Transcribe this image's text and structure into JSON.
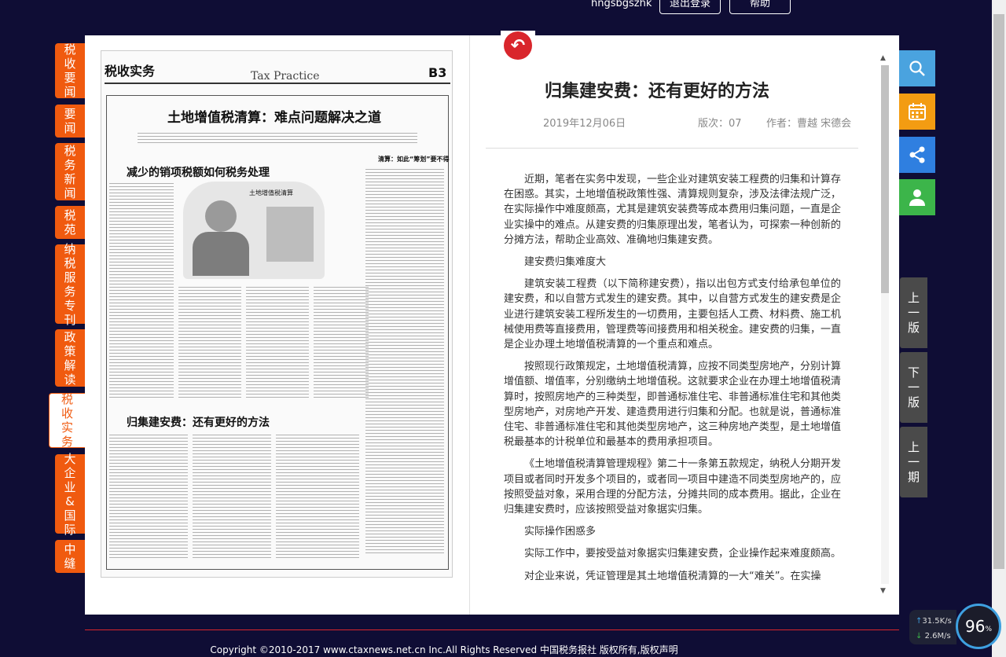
{
  "header": {
    "username": "hngsbgszhk",
    "logout_label": "退出登录",
    "help_label": "帮助"
  },
  "left_nav": [
    {
      "label": "税收要闻",
      "active": false
    },
    {
      "label": "要闻",
      "active": false
    },
    {
      "label": "税务新闻",
      "active": false
    },
    {
      "label": "税苑",
      "active": false
    },
    {
      "label": "纳税服务专刊",
      "active": false
    },
    {
      "label": "政策解读",
      "active": false
    },
    {
      "label": "税收实务",
      "active": true
    },
    {
      "label": "大企业&国际",
      "active": false
    },
    {
      "label": "中缝",
      "active": false
    }
  ],
  "newspaper": {
    "section_cn": "税收实务",
    "section_en": "Tax Practice",
    "page_code": "B3",
    "headline": "土地增值税清算：难点问题解决之道",
    "story1_title": "减少的销项税额如何税务处理",
    "story2_title": "归集建安费：还有更好的方法",
    "side_title": "清算：如此“筹划”要不得",
    "figure_label": "土地增值税清算"
  },
  "article": {
    "title": "归集建安费：还有更好的方法",
    "date": "2019年12月06日",
    "edition": "版次：07",
    "author": "作者：曹越 宋德会",
    "paragraphs": [
      "近期，笔者在实务中发现，一些企业对建筑安装工程费的归集和计算存在困惑。其实，土地增值税政策性强、清算规则复杂，涉及法律法规广泛，在实际操作中难度颇高，尤其是建筑安装费等成本费用归集问题，一直是企业实操中的难点。从建安费的归集原理出发，笔者认为，可探索一种创新的分摊方法，帮助企业高效、准确地归集建安费。",
      "建安费归集难度大",
      "建筑安装工程费（以下简称建安费），指以出包方式支付给承包单位的建安费，和以自营方式发生的建安费。其中，以自营方式发生的建安费是企业进行建筑安装工程所发生的一切费用，主要包括人工费、材料费、施工机械使用费等直接费用，管理费等间接费用和相关税金。建安费的归集，一直是企业办理土地增值税清算的一个重点和难点。",
      "按照现行政策规定，土地增值税清算，应按不同类型房地产，分别计算增值额、增值率，分别缴纳土地增值税。这就要求企业在办理土地增值税清算时，按照房地产的三种类型，即普通标准住宅、非普通标准住宅和其他类型房地产，对房地产开发、建造费用进行归集和分配。也就是说，普通标准住宅、非普通标准住宅和其他类型房地产，这三种房地产类型，是土地增值税最基本的计税单位和最基本的费用承担项目。",
      "《土地增值税清算管理规程》第二十一条第五款规定，纳税人分期开发项目或者同时开发多个项目的，或者同一项目中建造不同类型房地产的，应按照受益对象，采用合理的分配方法，分摊共同的成本费用。据此，企业在归集建安费时，应该按照受益对象据实归集。",
      "实际操作困惑多",
      "实际工作中，要按受益对象据实归集建安费，企业操作起来难度颇高。",
      "对企业来说，凭证管理是其土地增值税清算的一大“难关”。在实操"
    ]
  },
  "right_tools": [
    {
      "icon": "search-icon",
      "color": "#4aa3df"
    },
    {
      "icon": "calendar-icon",
      "color": "#f39c12"
    },
    {
      "icon": "share-icon",
      "color": "#2f7fe0"
    },
    {
      "icon": "user-icon",
      "color": "#3cb54a"
    }
  ],
  "pager": {
    "prev_page": "上一版",
    "next_page": "下一版",
    "prev_issue": "上一期"
  },
  "footer": {
    "copyright": "Copyright ©2010-2017 www.ctaxnews.net.cn Inc.All Rights Reserved 中国税务报社 版权所有,版权声明"
  },
  "netmon": {
    "up": "31.5K/s",
    "down": "2.6M/s",
    "percent": "96"
  },
  "colors": {
    "nav_orange": "#f05a0f",
    "accent_red": "#d9262c",
    "page_bg": "#0f0d35"
  }
}
